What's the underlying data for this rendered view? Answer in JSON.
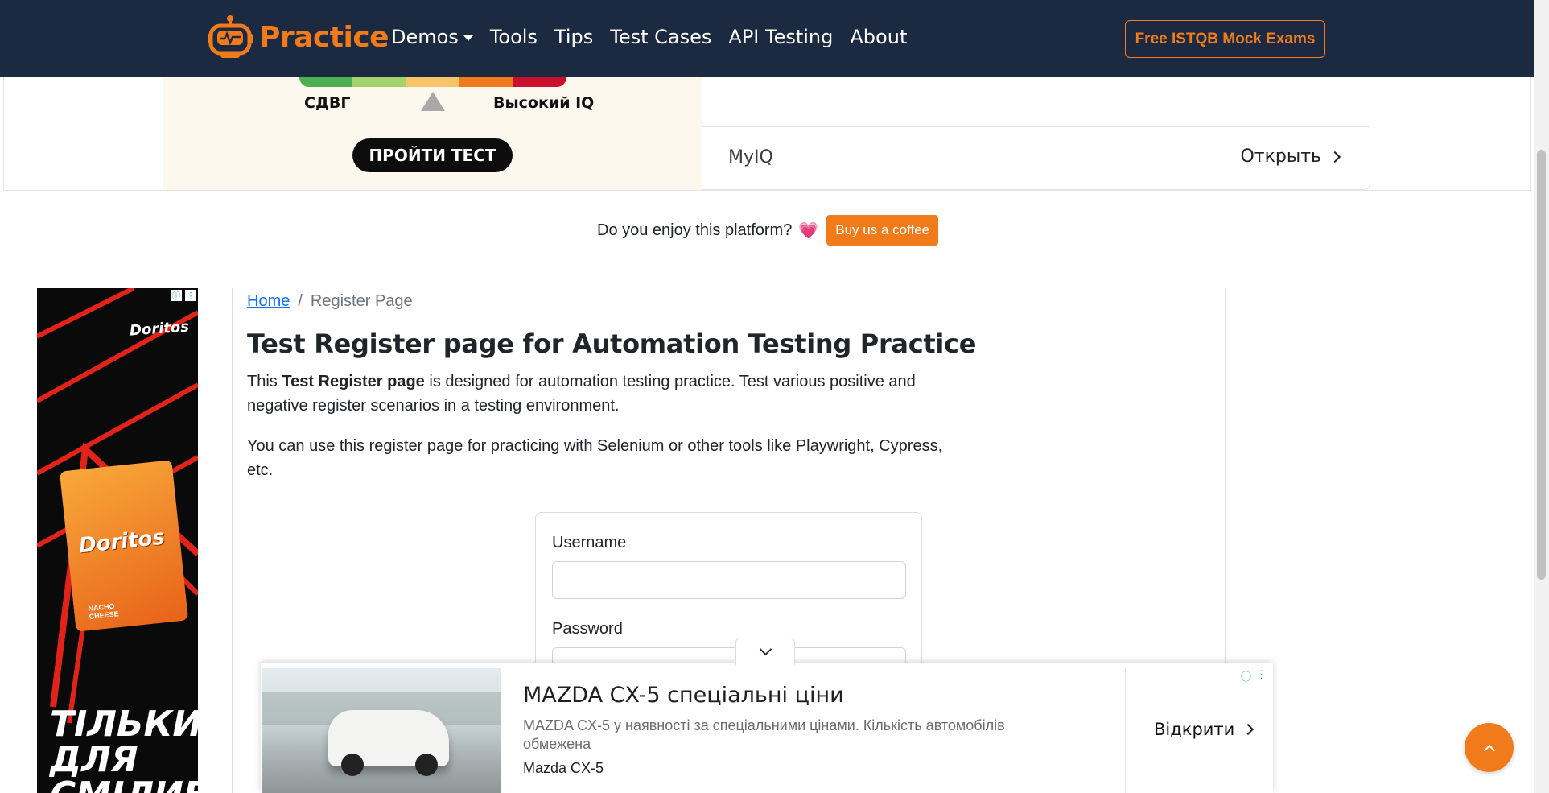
{
  "navbar": {
    "brand": "Practice",
    "links": [
      {
        "label": "Demos",
        "dropdown": true
      },
      {
        "label": "Tools"
      },
      {
        "label": "Tips"
      },
      {
        "label": "Test Cases"
      },
      {
        "label": "API Testing"
      },
      {
        "label": "About"
      }
    ],
    "cta_label": "Free ISTQB Mock Exams"
  },
  "top_ad": {
    "left_label": "СДВГ",
    "right_label": "Высокий IQ",
    "button_label": "ПРОЙТИ ТЕСТ",
    "brand": "MyIQ",
    "open_label": "Открыть",
    "scale_colors": [
      "#4caf50",
      "#a5d36b",
      "#f7c46a",
      "#f17b1b",
      "#c8102e"
    ]
  },
  "coffee": {
    "text": "Do you enjoy this platform?",
    "heart": "💗",
    "button_label": "Buy us a coffee"
  },
  "left_ad": {
    "brand": "Doritos",
    "bag_brand": "Doritos",
    "bag_flavor": "NACHO CHEESE",
    "slogan": "ТІЛЬКИ ДЛЯ СМІЛИВИХ"
  },
  "breadcrumb": {
    "home": "Home",
    "separator": "/",
    "current": "Register Page"
  },
  "main": {
    "title": "Test Register page for Automation Testing Practice",
    "intro_pre": "This ",
    "intro_bold": "Test Register page",
    "intro_post": " is designed for automation testing practice. Test various positive and negative register scenarios in a testing environment.",
    "intro2": "You can use this register page for practicing with Selenium or other tools like Playwright, Cypress, etc."
  },
  "form": {
    "username_label": "Username",
    "username_value": "",
    "password_label": "Password",
    "password_value": ""
  },
  "bottom_ad": {
    "title": "MAZDA CX-5 спеціальні ціни",
    "description": "MAZDA CX-5 у наявності за спеціальними цінами. Кількість автомобілів обмежена",
    "brand": "Mazda CX-5",
    "open_label": "Відкрити"
  },
  "colors": {
    "navbar_bg": "#1b2a41",
    "accent": "#f17b1b",
    "link": "#0d6efd"
  }
}
